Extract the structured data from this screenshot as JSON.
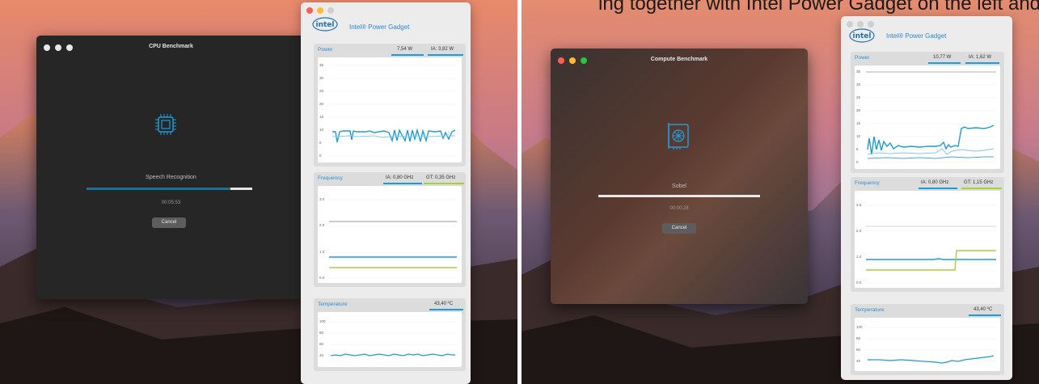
{
  "caption": "ing together with Intel Power Gadget on the left and Compute",
  "colors": {
    "dark_window": "#262626",
    "accent_blue": "#1e9cd8",
    "accent_green": "#a9cf3c",
    "gray_line": "#9a9a9a",
    "traffic_red": "#ff5f57",
    "traffic_yellow": "#febc2e",
    "traffic_green": "#28c840",
    "traffic_inactive": "#cfcfcf"
  },
  "left": {
    "benchmark": {
      "title": "CPU Benchmark",
      "icon": "cpu-chip-icon",
      "task": "Speech Recognition",
      "elapsed": "00:05:53",
      "cancel_label": "Cancel",
      "progress_fraction": 0.87
    },
    "gadget": {
      "brand": "Intel® Power Gadget",
      "logo_text": "intel",
      "power": {
        "label": "Power",
        "ia_power": "7,54 W",
        "ia_label": "IA: 3,82 W",
        "ticks": [
          "35",
          "30",
          "25",
          "20",
          "15",
          "10",
          "5",
          "0"
        ]
      },
      "frequency": {
        "label": "Frequency",
        "ia": "IA: 0,80 GHz",
        "gt": "GT: 0,35 GHz",
        "ticks": [
          "3.0",
          "2.0",
          "1.0",
          "0.0"
        ]
      },
      "temperature": {
        "label": "Temperature",
        "value": "43,40 ºC",
        "ticks": [
          "100",
          "80",
          "60",
          "40"
        ]
      }
    }
  },
  "right": {
    "benchmark": {
      "title": "Compute Benchmark",
      "icon": "gpu-card-icon",
      "task": "Sobel",
      "elapsed": "00:00:28",
      "cancel_label": "Cancel",
      "progress_fraction": 1.0
    },
    "gadget": {
      "brand": "Intel® Power Gadget",
      "logo_text": "intel",
      "power": {
        "label": "Power",
        "ia_power": "10,77 W",
        "ia_label": "IA: 1,62 W",
        "ticks": [
          "35",
          "30",
          "25",
          "20",
          "15",
          "10",
          "5",
          "0"
        ]
      },
      "frequency": {
        "label": "Frequency",
        "ia": "IA: 0,80 GHz",
        "gt": "GT: 1,15 GHz",
        "ticks": [
          "3.0",
          "2.0",
          "1.0",
          "0.0"
        ]
      },
      "temperature": {
        "label": "Temperature",
        "value": "43,40 ºC",
        "ticks": [
          "100",
          "80",
          "60",
          "40"
        ]
      }
    }
  }
}
